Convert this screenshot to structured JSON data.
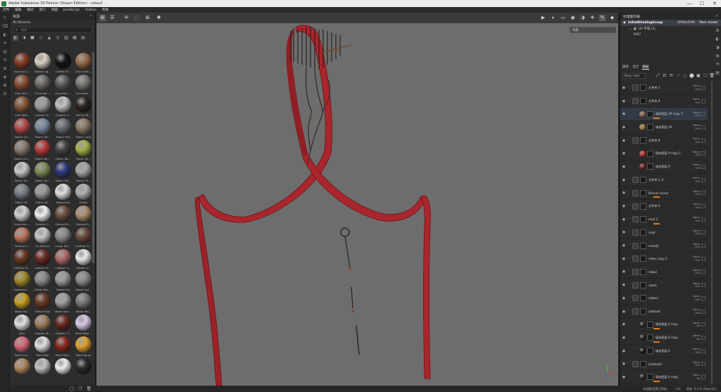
{
  "window": {
    "title": "Adobe Substance 3D Painter (Steam Edition) - robes2",
    "controls": [
      "—",
      "☐",
      "✕"
    ]
  },
  "menu": [
    "文件",
    "编辑",
    "模式",
    "窗口",
    "视图",
    "JavaScript",
    "Python",
    "帮助"
  ],
  "tools": [
    "✎",
    "⌫",
    "◐",
    "✦",
    "◍",
    "⟲",
    "⊕",
    "◈",
    "⊞",
    "⊟"
  ],
  "shelf": {
    "title": "资源",
    "close": "✕",
    "breadcrumb": "All libraries",
    "search_placeholder": "搜索",
    "filter_icons": [
      "◐",
      "◑",
      "■",
      "◇",
      "▲",
      "◎",
      "▥",
      "▦",
      "▤"
    ],
    "materials": [
      {
        "label": "Autumn L...",
        "color": "#8a3b22"
      },
      {
        "label": "Baked Lig...",
        "color": "#d8d0c0"
      },
      {
        "label": "Carbon Fi...",
        "color": "#151515"
      },
      {
        "label": "Clay Earth...",
        "color": "#9a6b4a"
      },
      {
        "label": "Clay Sim...",
        "color": "#8b4e34"
      },
      {
        "label": "Concrete ...",
        "color": "#6d6a66"
      },
      {
        "label": "Concrete ...",
        "color": "#5e5c5a"
      },
      {
        "label": "Concrete ...",
        "color": "#7a7874"
      },
      {
        "label": "Cork Nat...",
        "color": "#8a5a3a"
      },
      {
        "label": "Custom S...",
        "color": "#a0a0a0"
      },
      {
        "label": "Custom S...",
        "color": "#c0c0c0"
      },
      {
        "label": "Denim Ri...",
        "color": "#2e2520"
      },
      {
        "label": "Fabric Ca...",
        "color": "#b84c4c"
      },
      {
        "label": "Fabric De...",
        "color": "#7a8aa0"
      },
      {
        "label": "Fabric Felt",
        "color": "#6a6f78"
      },
      {
        "label": "Fabric Lace",
        "color": "#8a7a66"
      },
      {
        "label": "Fabric Lin...",
        "color": "#8a7c70"
      },
      {
        "label": "Fabric Ne...",
        "color": "#b83a3a"
      },
      {
        "label": "Fabric Ro...",
        "color": "#444444"
      },
      {
        "label": "Fabric Sk...",
        "color": "#a6b04a"
      },
      {
        "label": "Fabric So...",
        "color": "#c9c9c9"
      },
      {
        "label": "Fabric Sp...",
        "color": "#7f8a5a"
      },
      {
        "label": "Fabric Tar...",
        "color": "#2e3a7a"
      },
      {
        "label": "Fabric Tri...",
        "color": "#a8a8a8"
      },
      {
        "label": "Fabric W...",
        "color": "#7a7f88"
      },
      {
        "label": "Fabric W...",
        "color": "#9a9a9a"
      },
      {
        "label": "Footprints",
        "color": "#e0e0e0"
      },
      {
        "label": "Glitter",
        "color": "#b0b0b0"
      },
      {
        "label": "Gouache ...",
        "color": "#d0d0d0"
      },
      {
        "label": "Graphic I...",
        "color": "#f0f0f0"
      },
      {
        "label": "Ground R...",
        "color": "#6a5040"
      },
      {
        "label": "Ground S...",
        "color": "#b09070"
      },
      {
        "label": "Human F...",
        "color": "#c07860"
      },
      {
        "label": "Ivy Branch",
        "color": "#c8c8c8"
      },
      {
        "label": "Large Kni...",
        "color": "#8a8a8a"
      },
      {
        "label": "Leather G...",
        "color": "#6a4a3a"
      },
      {
        "label": "Leather B...",
        "color": "#6a3a24"
      },
      {
        "label": "Leather S...",
        "color": "#6a2a22"
      },
      {
        "label": "Leather S...",
        "color": "#b06a6a"
      },
      {
        "label": "Marble V...",
        "color": "#e8e8e8"
      },
      {
        "label": "Medieval ...",
        "color": "#a08a2a"
      },
      {
        "label": "Metal Bro...",
        "color": "#888888"
      },
      {
        "label": "Metal Foil",
        "color": "#9a9a9a"
      },
      {
        "label": "Metal Gal...",
        "color": "#8a8a8a"
      },
      {
        "label": "Metal Pol...",
        "color": "#c8a020"
      },
      {
        "label": "Metal Rust",
        "color": "#6a3a24"
      },
      {
        "label": "Metal San...",
        "color": "#a0a0a0"
      },
      {
        "label": "Metal Wo...",
        "color": "#7a7a7a"
      },
      {
        "label": "Noir",
        "color": "#e0e0e0"
      },
      {
        "label": "Organic B...",
        "color": "#a08060"
      },
      {
        "label": "Organic T...",
        "color": "#6a2a22"
      },
      {
        "label": "Paint Bloo...",
        "color": "#d8c8e8"
      },
      {
        "label": "Paint Cra...",
        "color": "#d86a7a"
      },
      {
        "label": "Paint Roll",
        "color": "#e0e0e0"
      },
      {
        "label": "Paint Roll...",
        "color": "#8a2a22"
      },
      {
        "label": "Paint Spray",
        "color": "#e0a030"
      },
      {
        "label": "",
        "color": "#b08860"
      },
      {
        "label": "",
        "color": "#c0c0c0"
      },
      {
        "label": "",
        "color": "#ececec"
      },
      {
        "label": "",
        "color": "#2a2a2a"
      }
    ],
    "footer_icons": [
      "◯",
      "❐",
      "🗑"
    ]
  },
  "viewport": {
    "toolbar_left": [
      "⊞",
      "☰",
      "✣",
      "⬚",
      "⊠",
      "✺"
    ],
    "toolbar_right": [
      "▶",
      "⏸",
      "▭",
      "◉",
      "◑",
      "❄",
      "✎",
      "◆",
      "⬤"
    ],
    "display_mode": "材质",
    "colors": {
      "strap": "#a8262c",
      "strap_dark": "#6e1619",
      "beads": "#2b2220",
      "cord": "#3a3230",
      "bg": "#6d6d6d"
    }
  },
  "status": {
    "left": "纹理集设置已更新。",
    "mid": "13s",
    "version": "版本: 9.1.0 (OpenGL)"
  },
  "texture_set": {
    "title": "纹理集列表",
    "close": "✕",
    "row_name": "initialShadingGroup",
    "row_res": "4096x4096",
    "row_shader": "Main shader",
    "uv_label": "UV 平铺 (1)",
    "uv_sub": "1007"
  },
  "layer_panel": {
    "tabs": [
      "属性",
      "显示",
      "图层"
    ],
    "blend": "Base color",
    "tool_icons": [
      "⤢",
      "⊡",
      "⟳",
      "⟋",
      "◌",
      "⬤",
      "▣",
      "🗀",
      "🗑"
    ],
    "layers": [
      {
        "name": "文件夹 1",
        "kind": "folder",
        "blend": "Norm",
        "op": "100"
      },
      {
        "name": "文件夹 8",
        "kind": "folder",
        "blend": "Norm",
        "op": "100"
      },
      {
        "name": "填充图层 19 copy 1",
        "kind": "fill",
        "blend": "Norm",
        "op": "100",
        "selected": true,
        "ball": "#9a6b4a",
        "orange": true
      },
      {
        "name": "填充图层 19",
        "kind": "fill",
        "blend": "Norm",
        "op": "100",
        "ball": "#a58a4a"
      },
      {
        "name": "文件夹 6",
        "kind": "folder",
        "blend": "Norm",
        "op": "100"
      },
      {
        "name": "填充图层 9 copy 1",
        "kind": "fill",
        "blend": "Norm",
        "op": "100",
        "ball": "#c83a3a"
      },
      {
        "name": "填充图层 9",
        "kind": "fill",
        "blend": "Norm",
        "op": "100",
        "ball": "#8a2a2a"
      },
      {
        "name": "文件夹 1_2",
        "kind": "folder",
        "blend": "Norm",
        "op": "100"
      },
      {
        "name": "Bronze Armor",
        "kind": "folder",
        "blend": "Norm",
        "op": "100",
        "orange": true
      },
      {
        "name": "文件夹 6",
        "kind": "folder",
        "blend": "Norm",
        "op": "100"
      },
      {
        "name": "mod 2",
        "kind": "folder",
        "blend": "Norm",
        "op": "100",
        "orange": true
      },
      {
        "name": "mod",
        "kind": "folder",
        "blend": "Norm",
        "op": "100"
      },
      {
        "name": "metal2",
        "kind": "folder",
        "blend": "Norm",
        "op": "100"
      },
      {
        "name": "robes copy 1",
        "kind": "folder",
        "blend": "Norm",
        "op": "100"
      },
      {
        "name": "robe2",
        "kind": "folder",
        "blend": "Norm",
        "op": "100"
      },
      {
        "name": "robe1",
        "kind": "folder",
        "blend": "Norm",
        "op": "100"
      },
      {
        "name": "zibbon",
        "kind": "folder",
        "blend": "Norm",
        "op": "100"
      },
      {
        "name": "jadeball",
        "kind": "folder",
        "blend": "Norm",
        "op": "100"
      },
      {
        "name": "填充图层 6 copy",
        "kind": "fill",
        "blend": "Norm",
        "op": "50",
        "ball": "#2a2a2a",
        "orange": true
      },
      {
        "name": "填充图层 6 copy",
        "kind": "fill",
        "blend": "Norm",
        "op": "50",
        "ball": "#2a2a2a",
        "orange": true
      },
      {
        "name": "填充图层 6",
        "kind": "fill",
        "blend": "Norm",
        "op": "100",
        "ball": "#1a1a1a"
      },
      {
        "name": "jadeball2",
        "kind": "folder",
        "blend": "Norm",
        "op": "100"
      },
      {
        "name": "填充图层 6 copy",
        "kind": "fill",
        "blend": "Norm",
        "op": "50",
        "ball": "#2a2a2a",
        "orange": true
      }
    ]
  },
  "right_rail": [
    "⚙",
    "◐",
    "◑",
    "◍",
    "⟲",
    "▤"
  ]
}
